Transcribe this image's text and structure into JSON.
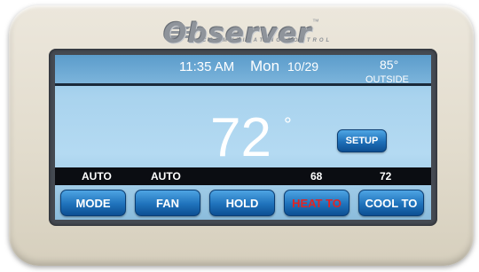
{
  "brand": {
    "name": "Observer",
    "tagline": "COMMUNICATING CONTROL",
    "tm": "™"
  },
  "header": {
    "time": "11:35 AM",
    "day": "Mon",
    "date": "10/29",
    "outside_temp": "85°",
    "outside_label": "OUTSIDE"
  },
  "main": {
    "current_temp": "72",
    "degree": "°",
    "setup_label": "SETUP"
  },
  "status": {
    "mode": "AUTO",
    "fan": "AUTO",
    "heat_setpoint": "68",
    "cool_setpoint": "72"
  },
  "buttons": {
    "mode": "MODE",
    "fan": "FAN",
    "hold": "HOLD",
    "heat_to": "HEAT TO",
    "cool_to": "COOL TO"
  },
  "colors": {
    "heat_text": "#e02424",
    "button_blue": "#1f72bb",
    "screen_blue": "#a9d3ee"
  }
}
